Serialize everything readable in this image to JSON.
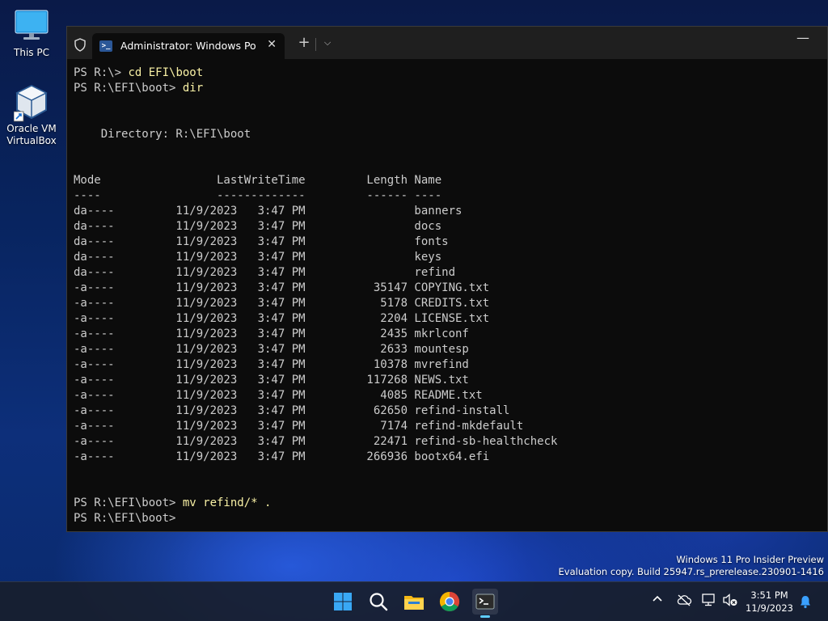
{
  "desktop": {
    "icons": [
      {
        "label": "This PC"
      },
      {
        "label": "Oracle VM\nVirtualBox"
      }
    ]
  },
  "terminal": {
    "tab_title": "Administrator: Windows PowerShell",
    "new_tab_glyph": "+",
    "dropdown_glyph": "⌵",
    "close_glyph": "✕",
    "minimize_glyph": "—",
    "lines": [
      {
        "prompt": "PS R:\\> ",
        "command": "cd EFI\\boot",
        "text": ""
      },
      {
        "prompt": "PS R:\\EFI\\boot> ",
        "command": "dir",
        "text": ""
      },
      {
        "prompt": "",
        "command": "",
        "text": ""
      },
      {
        "prompt": "",
        "command": "",
        "text": ""
      },
      {
        "prompt": "",
        "command": "",
        "text": "    Directory: R:\\EFI\\boot"
      },
      {
        "prompt": "",
        "command": "",
        "text": ""
      },
      {
        "prompt": "",
        "command": "",
        "text": ""
      },
      {
        "prompt": "",
        "command": "",
        "text": "Mode                 LastWriteTime         Length Name"
      },
      {
        "prompt": "",
        "command": "",
        "text": "----                 -------------         ------ ----"
      },
      {
        "prompt": "",
        "command": "",
        "text": "da----         11/9/2023   3:47 PM                banners"
      },
      {
        "prompt": "",
        "command": "",
        "text": "da----         11/9/2023   3:47 PM                docs"
      },
      {
        "prompt": "",
        "command": "",
        "text": "da----         11/9/2023   3:47 PM                fonts"
      },
      {
        "prompt": "",
        "command": "",
        "text": "da----         11/9/2023   3:47 PM                keys"
      },
      {
        "prompt": "",
        "command": "",
        "text": "da----         11/9/2023   3:47 PM                refind"
      },
      {
        "prompt": "",
        "command": "",
        "text": "-a----         11/9/2023   3:47 PM          35147 COPYING.txt"
      },
      {
        "prompt": "",
        "command": "",
        "text": "-a----         11/9/2023   3:47 PM           5178 CREDITS.txt"
      },
      {
        "prompt": "",
        "command": "",
        "text": "-a----         11/9/2023   3:47 PM           2204 LICENSE.txt"
      },
      {
        "prompt": "",
        "command": "",
        "text": "-a----         11/9/2023   3:47 PM           2435 mkrlconf"
      },
      {
        "prompt": "",
        "command": "",
        "text": "-a----         11/9/2023   3:47 PM           2633 mountesp"
      },
      {
        "prompt": "",
        "command": "",
        "text": "-a----         11/9/2023   3:47 PM          10378 mvrefind"
      },
      {
        "prompt": "",
        "command": "",
        "text": "-a----         11/9/2023   3:47 PM         117268 NEWS.txt"
      },
      {
        "prompt": "",
        "command": "",
        "text": "-a----         11/9/2023   3:47 PM           4085 README.txt"
      },
      {
        "prompt": "",
        "command": "",
        "text": "-a----         11/9/2023   3:47 PM          62650 refind-install"
      },
      {
        "prompt": "",
        "command": "",
        "text": "-a----         11/9/2023   3:47 PM           7174 refind-mkdefault"
      },
      {
        "prompt": "",
        "command": "",
        "text": "-a----         11/9/2023   3:47 PM          22471 refind-sb-healthcheck"
      },
      {
        "prompt": "",
        "command": "",
        "text": "-a----         11/9/2023   3:47 PM         266936 bootx64.efi"
      },
      {
        "prompt": "",
        "command": "",
        "text": ""
      },
      {
        "prompt": "",
        "command": "",
        "text": ""
      },
      {
        "prompt": "PS R:\\EFI\\boot> ",
        "command": "mv refind/* .",
        "text": ""
      },
      {
        "prompt": "PS R:\\EFI\\boot> ",
        "command": "",
        "text": ""
      }
    ]
  },
  "watermark": {
    "line1": "Windows 11 Pro Insider Preview",
    "line2": "Evaluation copy. Build 25947.rs_prerelease.230901-1416"
  },
  "taskbar": {
    "apps": [
      "start-icon",
      "search-icon",
      "file-explorer-icon",
      "chrome-icon",
      "terminal-icon"
    ],
    "tray_chevron": "^",
    "clock_time": "3:51 PM",
    "clock_date": "11/9/2023"
  },
  "colors": {
    "command": "#f9f1a5",
    "console_text": "#cccccc",
    "console_bg": "#0c0c0c",
    "accent": "#60cdff"
  }
}
